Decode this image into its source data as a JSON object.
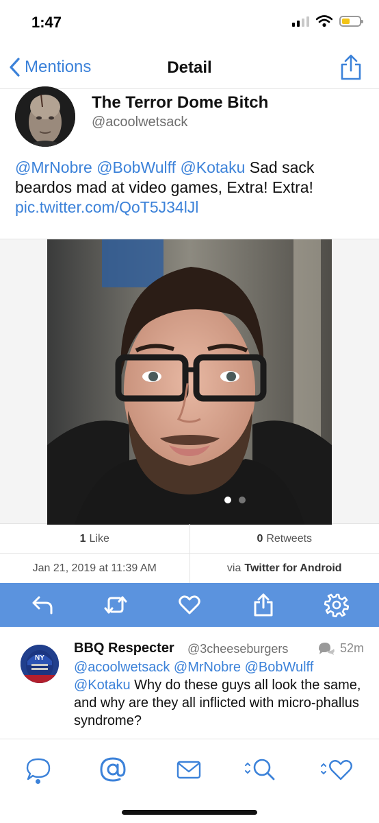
{
  "status_bar": {
    "time": "1:47",
    "battery_level": 0.45,
    "signal_bars": 2
  },
  "nav": {
    "back_label": "Mentions",
    "title": "Detail"
  },
  "tweet": {
    "display_name": "The Terror Dome Bitch",
    "handle": "@acoolwetsack",
    "mentions": [
      "@MrNobre",
      "@BobWulff",
      "@Kotaku"
    ],
    "text_line1": "Sad sack",
    "text_line2": "beardos mad at video games, Extra! Extra!",
    "media_link": "pic.twitter.com/QoT5J34lJl",
    "media_pages": 2,
    "media_active_page": 1
  },
  "stats": {
    "likes_count": "1",
    "likes_label": "Like",
    "retweets_count": "0",
    "retweets_label": "Retweets"
  },
  "meta": {
    "timestamp": "Jan 21, 2019 at 11:39 AM",
    "via_prefix": "via",
    "client": "Twitter for Android"
  },
  "actions": [
    "reply-icon",
    "retweet-icon",
    "heart-icon",
    "share-icon",
    "gear-icon"
  ],
  "reply": {
    "name": "BBQ Respecter",
    "handle": "@3cheeseburgers",
    "time": "52m",
    "mention_line1": "@acoolwetsack @MrNobre @BobWulff",
    "mention_line2": "@Kotaku",
    "text": "Why do these guys all look the same, and why are they all inflicted with micro-phallus syndrome?"
  },
  "tabs": [
    "timeline-icon",
    "mentions-icon",
    "messages-icon",
    "search-icon",
    "likes-icon"
  ],
  "colors": {
    "accent": "#3c82d9",
    "action_bar": "#5b93de",
    "battery": "#f2c418"
  }
}
